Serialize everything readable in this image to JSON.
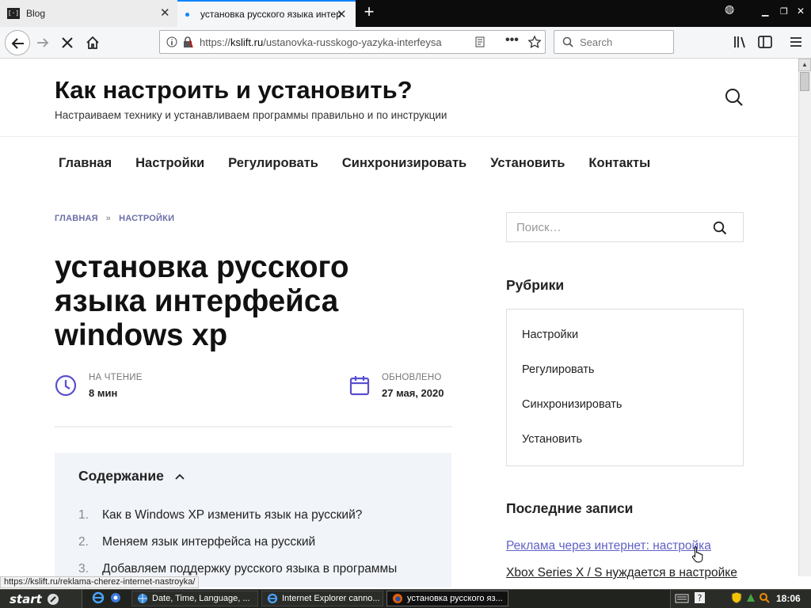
{
  "browser": {
    "tabs": [
      {
        "label": "Blog",
        "favicon": "[·] "
      },
      {
        "label": "установка русского языка интер"
      }
    ],
    "new_tab": "+",
    "url_prefix": "https://",
    "url_host": "kslift.ru",
    "url_path": "/ustanovka-russkogo-yazyka-interfeysa",
    "search_placeholder": "Search",
    "status_url": "https://kslift.ru/reklama-cherez-internet-nastroyka/"
  },
  "site": {
    "title": "Как настроить и установить?",
    "description": "Настраиваем технику и устанавливаем программы правильно и по инструкции",
    "menu": [
      "Главная",
      "Настройки",
      "Регулировать",
      "Синхронизировать",
      "Установить",
      "Контакты"
    ]
  },
  "article": {
    "breadcrumbs": [
      "ГЛАВНАЯ",
      "»",
      "НАСТРОЙКИ"
    ],
    "title": "установка русского языка интерфейса windows xp",
    "reading_label": "НА ЧТЕНИЕ",
    "reading_value": "8 мин",
    "updated_label": "ОБНОВЛЕНО",
    "updated_value": "27 мая, 2020",
    "toc_title": "Содержание",
    "toc_items": [
      {
        "num": "1.",
        "text": "Как в Windows XP изменить язык на русский?"
      },
      {
        "num": "2.",
        "text": "Меняем язык интерфейса на русский"
      },
      {
        "num": "3.",
        "text": "Добавляем поддержку русского языка в программы"
      }
    ]
  },
  "sidebar": {
    "search_placeholder": "Поиск…",
    "rubrics_title": "Рубрики",
    "rubrics": [
      "Настройки",
      "Регулировать",
      "Синхронизировать",
      "Установить"
    ],
    "recent_title": "Последние записи",
    "recent": [
      "Реклама через интернет: настройка",
      "Xbox Series X / S нуждается в настройке"
    ]
  },
  "taskbar": {
    "start": "start",
    "items": [
      "Date, Time, Language, ...",
      "Internet Explorer canno...",
      "установка русского яз..."
    ],
    "clock": "18:06"
  },
  "colors": {
    "accent": "#6a6fa8",
    "meta_icon": "#5a4fcf",
    "link": "#6062c4",
    "toc_bg": "#f1f4f9"
  }
}
